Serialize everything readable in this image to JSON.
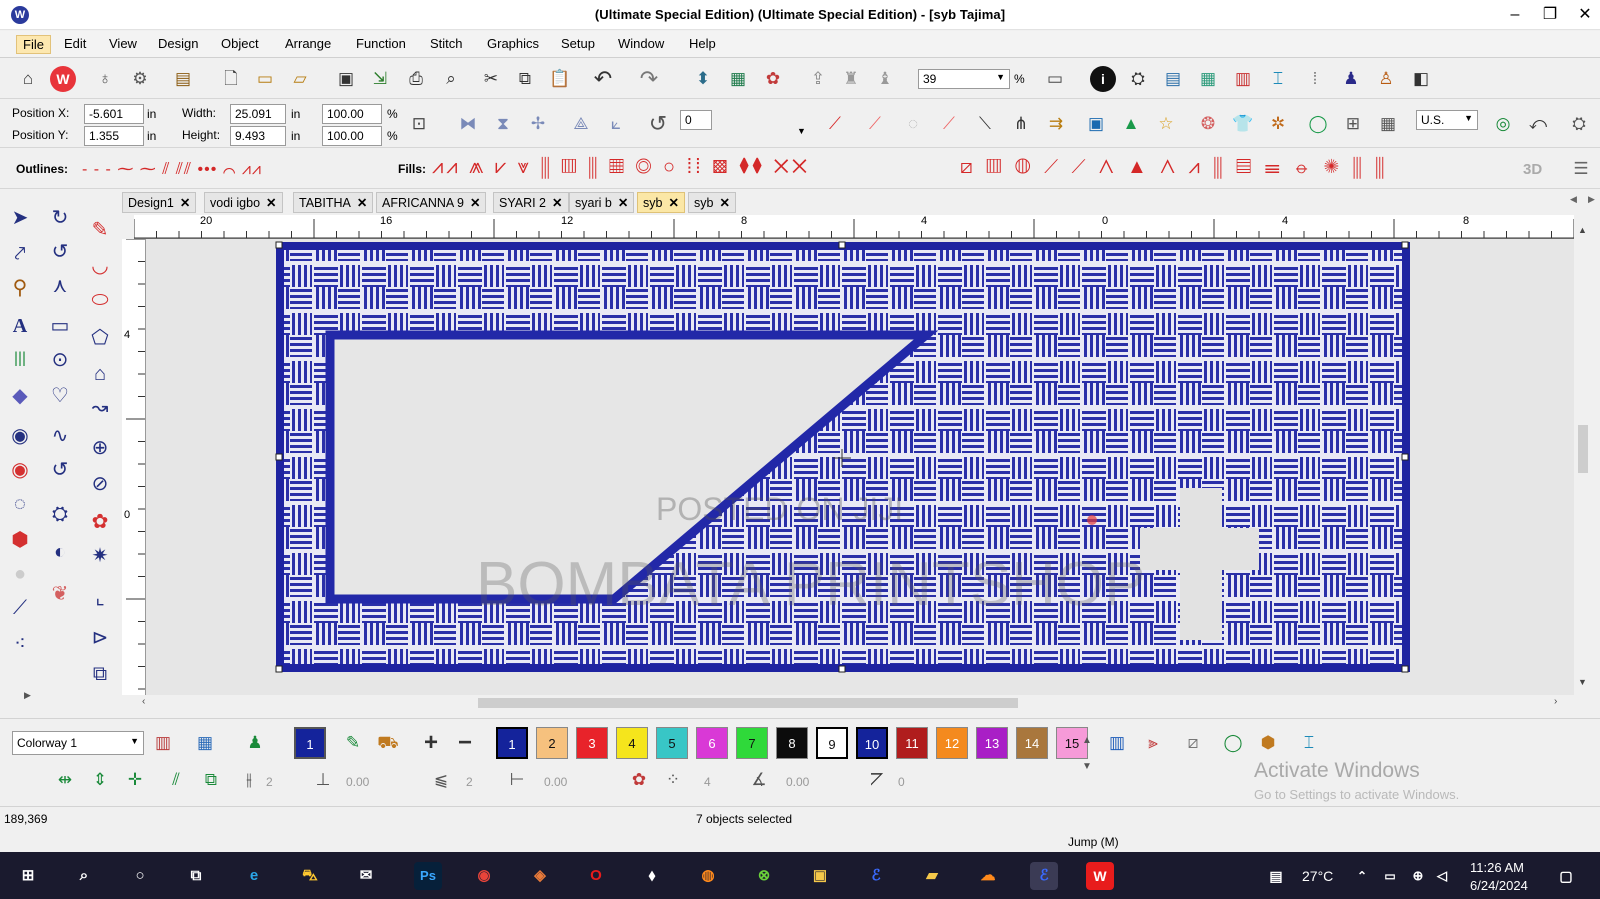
{
  "app": {
    "title": "(Ultimate Special Edition) (Ultimate Special Edition) - [syb      Tajima]"
  },
  "menu": [
    "File",
    "Edit",
    "View",
    "Design",
    "Object",
    "Arrange",
    "Function",
    "Stitch",
    "Graphics",
    "Setup",
    "Window",
    "Help"
  ],
  "toolbar": {
    "zoom_value": "39",
    "zoom_unit": "%"
  },
  "props": {
    "position_x_label": "Position X:",
    "position_x_value": "-5.601",
    "position_x_unit": "in",
    "position_y_label": "Position Y:",
    "position_y_value": "1.355",
    "position_y_unit": "in",
    "width_label": "Width:",
    "width_value": "25.091",
    "width_unit": "in",
    "height_label": "Height:",
    "height_value": "9.493",
    "height_unit": "in",
    "scale_x": "100.00",
    "scale_y": "100.00",
    "pct": "%",
    "rotation_value": "0",
    "units_select": "U.S."
  },
  "outlines_label": "Outlines:",
  "fills_label": "Fills:",
  "fills_3d": "3D",
  "tabs": [
    "Design1",
    "vodi igbo",
    "TABITHA",
    "AFRICANNA 9",
    "SYARI 2",
    "syari b",
    "syb",
    "syb"
  ],
  "active_tab_index": 6,
  "ruler_top": [
    "20",
    "16",
    "12",
    "8",
    "4",
    "0",
    "4",
    "8"
  ],
  "ruler_left": [
    "4",
    "0"
  ],
  "colorway": "Colorway 1",
  "swatches": [
    {
      "label": "1",
      "color": "#14239b"
    },
    {
      "label": "2",
      "color": "#f6c17e"
    },
    {
      "label": "3",
      "color": "#e8232a"
    },
    {
      "label": "4",
      "color": "#f5e51c"
    },
    {
      "label": "5",
      "color": "#38c6c6"
    },
    {
      "label": "6",
      "color": "#d939d6"
    },
    {
      "label": "7",
      "color": "#2fd93a"
    },
    {
      "label": "8",
      "color": "#0c0c0c"
    },
    {
      "label": "9",
      "color": "#ffffff"
    },
    {
      "label": "10",
      "color": "#14239b"
    },
    {
      "label": "11",
      "color": "#b01d1d"
    },
    {
      "label": "12",
      "color": "#f48a1e"
    },
    {
      "label": "13",
      "color": "#a91fc6"
    },
    {
      "label": "14",
      "color": "#a9773d"
    },
    {
      "label": "15",
      "color": "#f69ad8"
    }
  ],
  "bottom_fields": [
    "2",
    "0.00",
    "2",
    "0.00",
    "4",
    "0.00",
    "0"
  ],
  "status": {
    "coords": "189,369",
    "selected": "7 objects selected",
    "mode": "Jump (M)"
  },
  "watermark": {
    "line1": "POSTED ON JIJI",
    "line2": "BOMBATA PRINTSHOP"
  },
  "activate": {
    "title": "Activate Windows",
    "sub": "Go to Settings to activate Windows."
  },
  "taskbar": {
    "temp": "27°C",
    "time": "11:26 AM",
    "date": "6/24/2024",
    "ps_label": "Ps"
  }
}
